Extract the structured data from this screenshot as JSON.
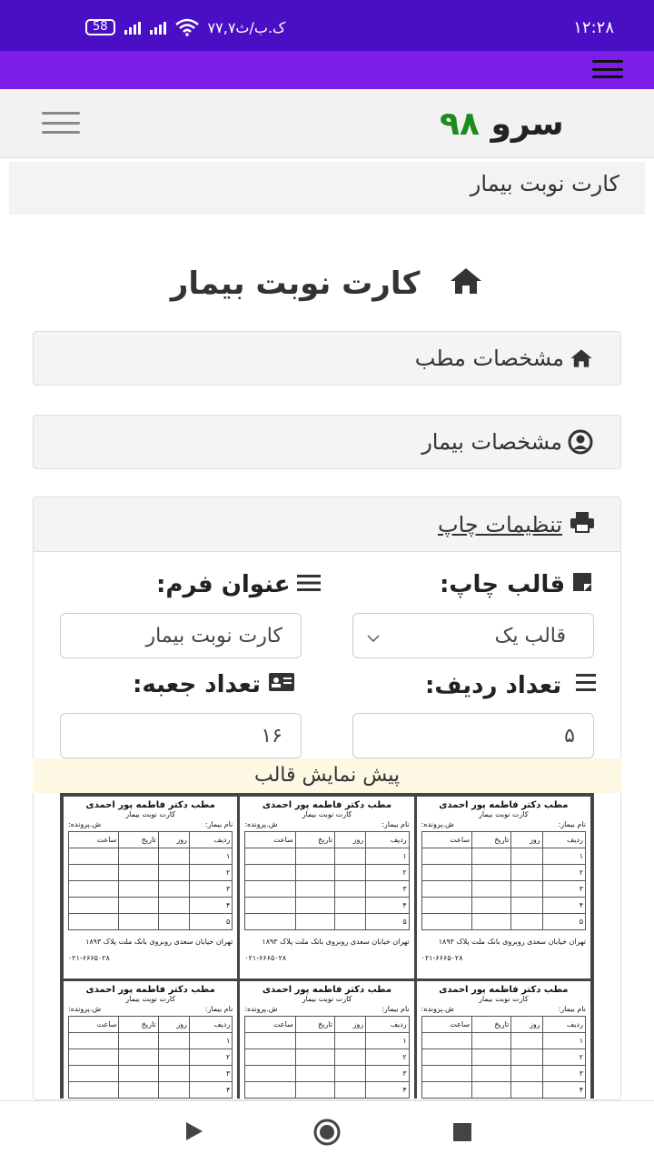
{
  "status_bar": {
    "time": "۱۲:۲۸",
    "battery": "58",
    "speed": "۷۷,۷ک.ب/ث"
  },
  "header": {
    "logo_word": "سرو",
    "logo_number": "۹۸",
    "breadcrumb": "کارت نوبت بیمار"
  },
  "page": {
    "title": "کارت نوبت بیمار"
  },
  "panels": {
    "clinic": "مشخصات مطب",
    "patient": "مشخصات بیمار",
    "print_settings": "تنظیمات چاپ"
  },
  "form": {
    "template_label": "قالب چاپ:",
    "template_value": "قالب یک",
    "form_title_label": "عنوان فرم:",
    "form_title_value": "کارت نوبت بیمار",
    "rows_label": "تعداد ردیف:",
    "rows_value": "۵",
    "boxes_label": "تعداد جعبه:",
    "boxes_value": "۱۶"
  },
  "preview": {
    "header": "پیش نمایش قالب",
    "card": {
      "doctor": "مطب دکتر فاطمه پور احمدی",
      "subtitle": "کارت نوبت بیمار",
      "name_label": "نام بیمار:",
      "file_label": "ش.پرونده:",
      "columns": [
        "ردیف",
        "روز",
        "تاریخ",
        "ساعت"
      ],
      "rows": [
        "۱",
        "۲",
        "۳",
        "۴",
        "۵"
      ],
      "address": "تهران خیابان سعدی روبروی بانک ملت پلاک ۱۸۹۳",
      "phone": "۰۲۱-۶۶۶۵۰۲۸"
    }
  }
}
